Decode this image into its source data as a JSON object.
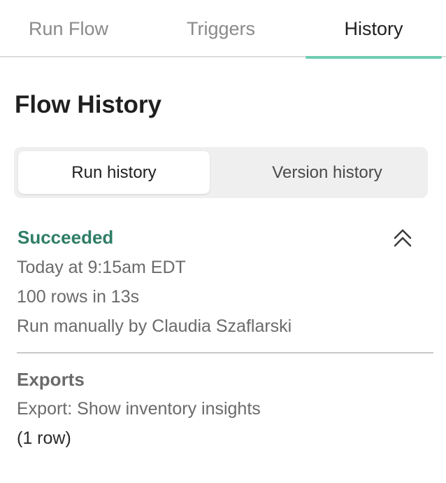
{
  "tabs": [
    {
      "label": "Run Flow",
      "active": false
    },
    {
      "label": "Triggers",
      "active": false
    },
    {
      "label": "History",
      "active": true
    }
  ],
  "page_title": "Flow History",
  "segmented": {
    "run_history": "Run history",
    "version_history": "Version history",
    "selected": "Run history"
  },
  "run": {
    "status": "Succeeded",
    "time": "Today at 9:15am EDT",
    "rows": "100 rows in 13s",
    "run_by": "Run manually by Claudia Szaflarski"
  },
  "exports": {
    "heading": "Exports",
    "item_label": "Export: Show inventory insights",
    "item_rows": "(1 row)"
  },
  "icons": {
    "collapse": "chevron-double-up-icon"
  },
  "colors": {
    "accent": "#6fcdb3",
    "success": "#2f7d66"
  }
}
